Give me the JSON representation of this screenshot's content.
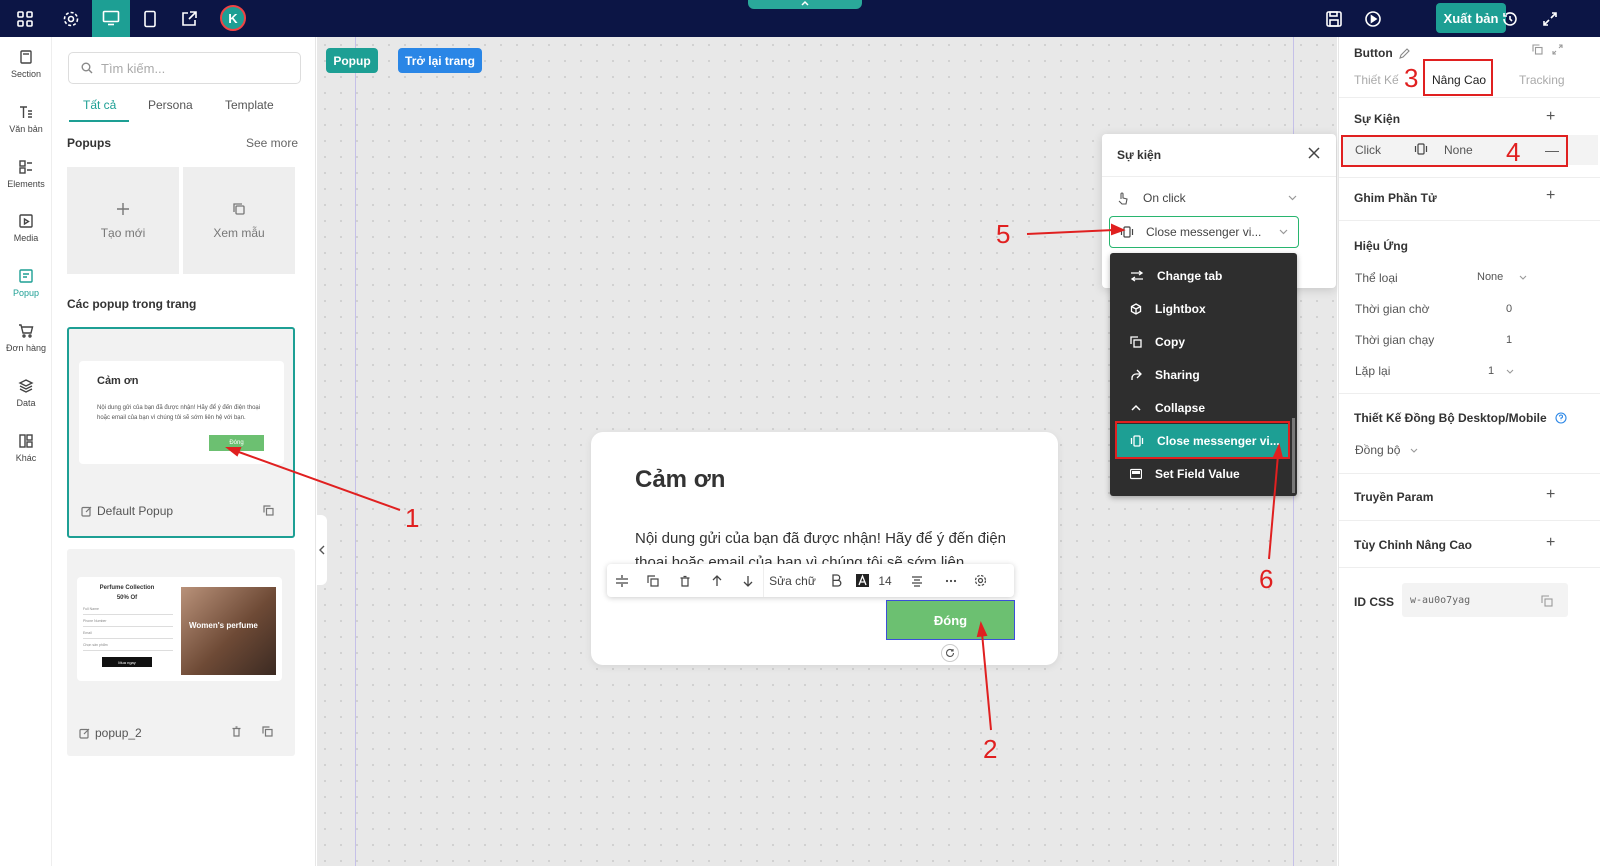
{
  "topbar": {
    "avatar_letter": "K",
    "publish_label": "Xuất bản"
  },
  "rail": [
    {
      "label": "Section",
      "icon": "section-icon"
    },
    {
      "label": "Văn bản",
      "icon": "text-icon"
    },
    {
      "label": "Elements",
      "icon": "elements-icon"
    },
    {
      "label": "Media",
      "icon": "media-icon"
    },
    {
      "label": "Popup",
      "icon": "popup-icon",
      "active": true
    },
    {
      "label": "Đơn hàng",
      "icon": "cart-icon"
    },
    {
      "label": "Data",
      "icon": "data-icon"
    },
    {
      "label": "Khác",
      "icon": "more-icon"
    }
  ],
  "left_panel": {
    "search_placeholder": "Tìm kiếm...",
    "tabs": [
      "Tất cả",
      "Persona",
      "Template"
    ],
    "popups_title": "Popups",
    "see_more": "See more",
    "create_new": "Tạo mới",
    "view_sample": "Xem mẫu",
    "in_page_title": "Các popup trong trang",
    "card1": {
      "thumb_title": "Cảm ơn",
      "thumb_body": "Nội dung gửi của bạn đã được nhận! Hãy để ý đến điện thoại hoặc email của bạn vì chúng tôi sẽ sớm liên hệ với bạn.",
      "thumb_button": "Đóng",
      "label": "Default Popup"
    },
    "card2": {
      "thumb_title": "Perfume Collection",
      "thumb_sub": "50% Of",
      "thumb_fields": [
        "Full Name",
        "Phone Number",
        "Email",
        "Chọn sản phẩm"
      ],
      "thumb_button": "Mua ngay",
      "thumb_image_text": "Women's perfume",
      "label": "popup_2"
    }
  },
  "canvas": {
    "popup_tag": "Popup",
    "back_button": "Trở lại trang",
    "popup": {
      "title": "Cảm ơn",
      "body": "Nội dung gửi của bạn đã được nhận! Hãy để ý đến điện thoại hoặc email của bạn vì chúng tôi sẽ sớm liên",
      "button": "Đóng"
    },
    "toolbar": {
      "edit_text": "Sửa chữ",
      "font_size": "14"
    }
  },
  "event_modal": {
    "title": "Sự kiện",
    "trigger": "On click",
    "action": "Close messenger vi..."
  },
  "dropdown": [
    {
      "label": "Change tab",
      "icon": "swap-icon"
    },
    {
      "label": "Lightbox",
      "icon": "cube-icon"
    },
    {
      "label": "Copy",
      "icon": "copy-icon"
    },
    {
      "label": "Sharing",
      "icon": "share-icon"
    },
    {
      "label": "Collapse",
      "icon": "chevron-up-icon"
    },
    {
      "label": "Close messenger vi...",
      "icon": "vibrate-icon",
      "selected": true
    },
    {
      "label": "Set Field Value",
      "icon": "field-icon"
    }
  ],
  "right_panel": {
    "element_type": "Button",
    "tabs": [
      "Thiết Kế",
      "Nâng Cao",
      "Tracking"
    ],
    "events_title": "Sự Kiện",
    "event_row": {
      "trigger": "Click",
      "action": "None"
    },
    "pin_title": "Ghim Phần Tử",
    "effect_title": "Hiệu Ứng",
    "effect_rows": [
      {
        "label": "Thể loại",
        "value": "None"
      },
      {
        "label": "Thời gian chờ",
        "value": "0"
      },
      {
        "label": "Thời gian chạy",
        "value": "1"
      },
      {
        "label": "Lặp lại",
        "value": "1"
      }
    ],
    "sync_title": "Thiết Kế Đồng Bộ Desktop/Mobile",
    "sync_value": "Đồng bộ",
    "param_title": "Truyền Param",
    "advanced_title": "Tùy Chỉnh Nâng Cao",
    "css_id_label": "ID CSS",
    "css_id_value": "w-au0o7yag"
  },
  "annotations": [
    "1",
    "2",
    "3",
    "4",
    "5",
    "6"
  ],
  "colors": {
    "topbar": "#0c1545",
    "accent": "#1d9f94",
    "blue": "#2a86e6",
    "annotation": "#e02020",
    "button_green": "#6cc071"
  }
}
